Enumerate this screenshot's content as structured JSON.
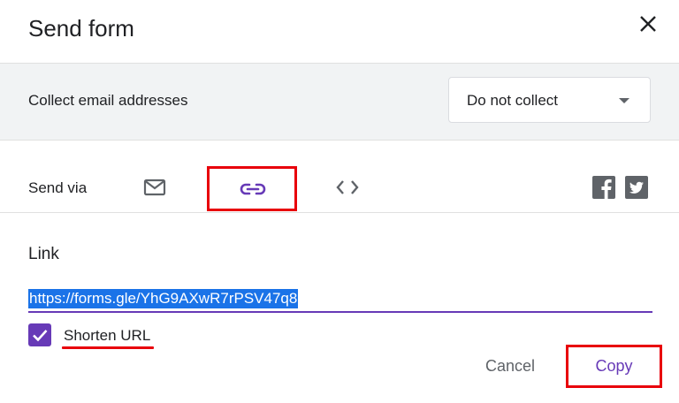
{
  "dialog": {
    "title": "Send form"
  },
  "collect": {
    "label": "Collect email addresses",
    "selected": "Do not collect"
  },
  "send_via": {
    "label": "Send via",
    "options": [
      {
        "icon": "mail-icon",
        "selected": false
      },
      {
        "icon": "link-icon",
        "selected": true
      },
      {
        "icon": "embed-code-icon",
        "selected": false
      }
    ],
    "social": [
      "facebook-icon",
      "twitter-icon"
    ]
  },
  "link": {
    "heading": "Link",
    "url": "https://forms.gle/YhG9AXwR7rPSV47q8",
    "shorten_label": "Shorten URL",
    "shorten_checked": true
  },
  "actions": {
    "cancel_label": "Cancel",
    "copy_label": "Copy"
  },
  "colors": {
    "accent": "#673ab7",
    "highlight_annotation": "#e8000b",
    "selection": "#1a73e8"
  }
}
